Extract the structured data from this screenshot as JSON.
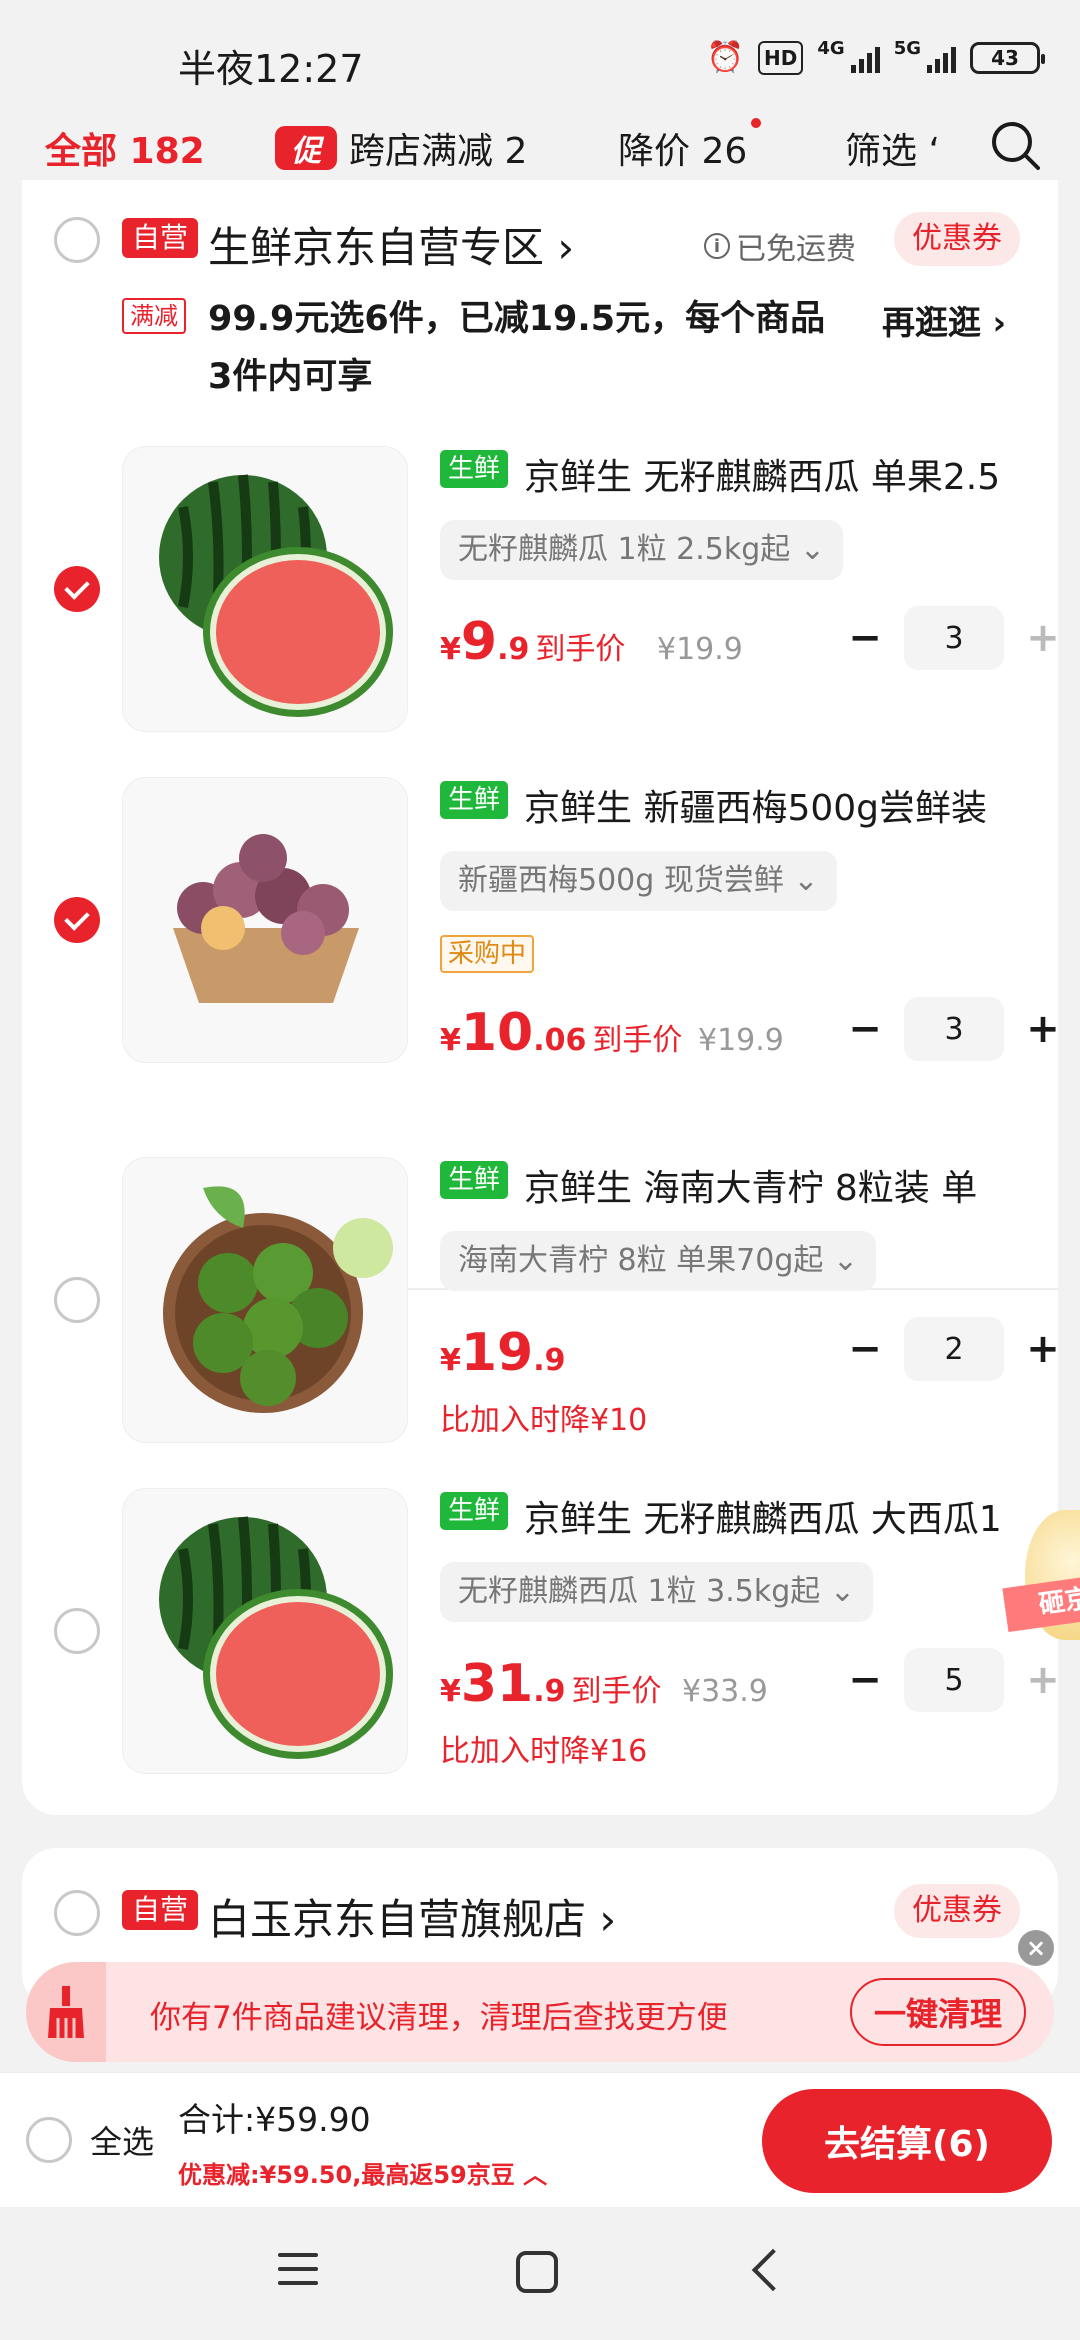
{
  "status_bar": {
    "time": "半夜12:27",
    "hd_label": "HD",
    "net1": "4G",
    "net2": "5G",
    "battery": "43"
  },
  "tabs": {
    "all": "全部 182",
    "promo_badge": "促",
    "promo": "跨店满减 2",
    "price_drop": "降价 26",
    "filter": "筛选 ‘"
  },
  "store1": {
    "self_badge": "自营",
    "name": "生鲜京东自营专区 ›",
    "free_shipping": "已免运费",
    "coupon": "优惠券",
    "promo_tag": "满减",
    "promo_text": "99.9元选6件，已减19.5元，每个商品3件内可享",
    "shop_more": "再逛逛 ›"
  },
  "items": [
    {
      "tag": "生鲜",
      "title": "京鲜生 无籽麒麟西瓜 单果2.5",
      "spec": "无籽麒麟瓜 1粒 2.5kg起 ⌄",
      "yen": "¥",
      "price_big": "9",
      "price_small": ".9",
      "price_label": "到手价",
      "orig": "¥19.9",
      "qty": "3",
      "minus": "−",
      "plus": "+"
    },
    {
      "tag": "生鲜",
      "title": "京鲜生 新疆西梅500g尝鲜装",
      "spec": "新疆西梅500g 现货尝鲜 ⌄",
      "buying": "采购中",
      "yen": "¥",
      "price_big": "10",
      "price_small": ".06",
      "price_label": "到手价",
      "orig": "¥19.9",
      "qty": "3",
      "minus": "−",
      "plus": "+"
    },
    {
      "tag": "生鲜",
      "title": "京鲜生 海南大青柠 8粒装 单",
      "spec": "海南大青柠 8粒 单果70g起 ⌄",
      "yen": "¥",
      "price_big": "19",
      "price_small": ".9",
      "drop_note": "比加入时降¥10",
      "qty": "2",
      "minus": "−",
      "plus": "+"
    },
    {
      "tag": "生鲜",
      "title": "京鲜生 无籽麒麟西瓜 大西瓜1",
      "spec": "无籽麒麟西瓜 1粒 3.5kg起 ⌄",
      "yen": "¥",
      "price_big": "31",
      "price_small": ".9",
      "price_label": "到手价",
      "orig": "¥33.9",
      "drop_note": "比加入时降¥16",
      "qty": "5",
      "minus": "−",
      "plus": "+"
    }
  ],
  "float_ribbon": "砸京",
  "store2": {
    "self_badge": "自营",
    "name": "白玉京东自营旗舰店 ›",
    "coupon": "优惠券"
  },
  "cleanup": {
    "text": "你有7件商品建议清理，清理后查找更方便",
    "button": "一键清理",
    "close": "×"
  },
  "bottom": {
    "select_all": "全选",
    "total": "合计:¥59.90",
    "discount": "优惠减:¥59.50,最高返59京豆 ︿",
    "checkout": "去结算(6)"
  }
}
